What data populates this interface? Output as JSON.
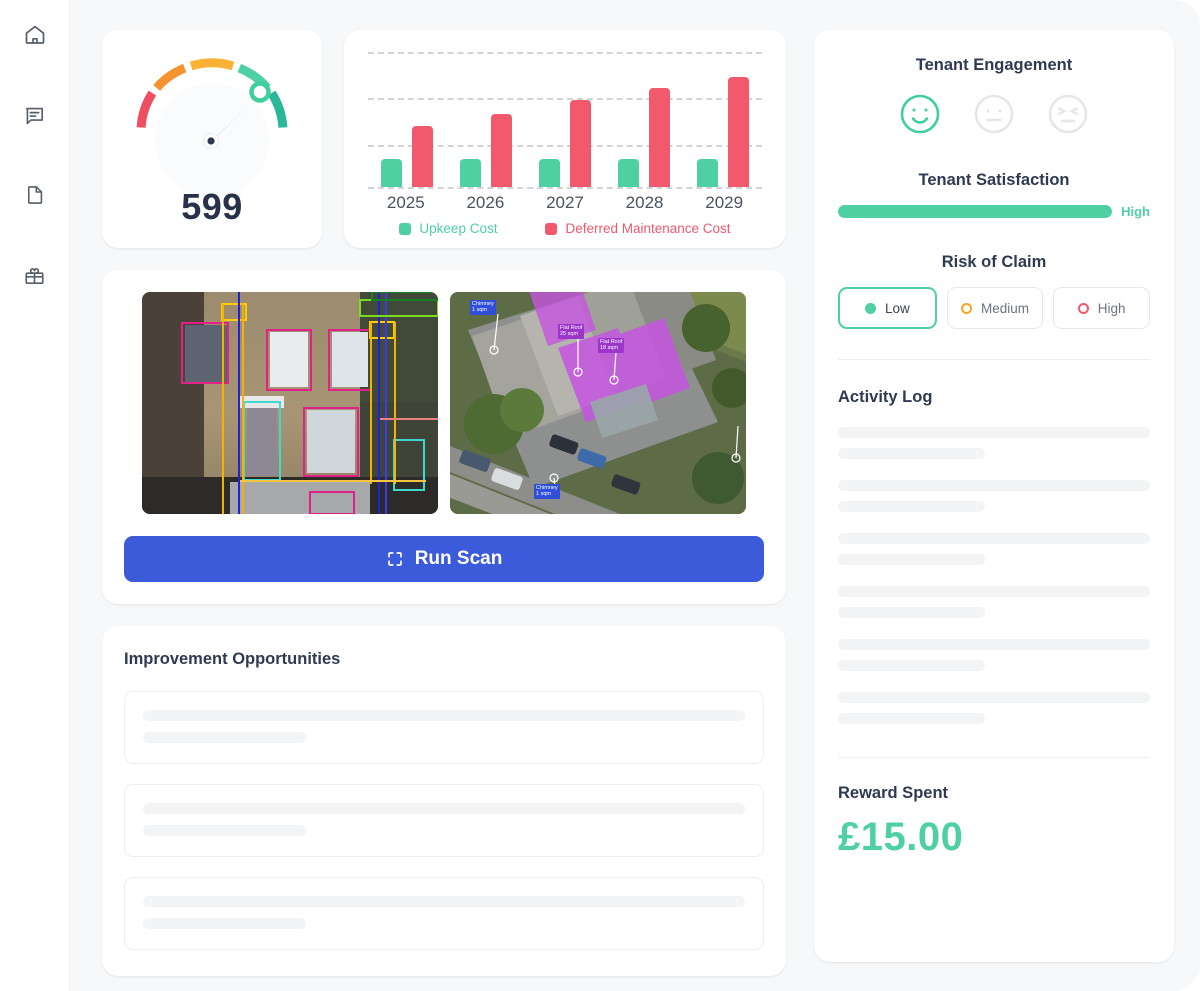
{
  "sidebar": {
    "items": [
      {
        "icon": "home-icon",
        "name": "home"
      },
      {
        "icon": "message-icon",
        "name": "messages"
      },
      {
        "icon": "document-icon",
        "name": "documents"
      },
      {
        "icon": "gift-icon",
        "name": "rewards"
      }
    ]
  },
  "gauge": {
    "value": "599",
    "needle_angle_deg": 48,
    "marker_angle_deg": 48,
    "segments": [
      {
        "name": "poor",
        "color": "#ef4f62"
      },
      {
        "name": "fair",
        "color": "#f5932e"
      },
      {
        "name": "good",
        "color": "#f9b233"
      },
      {
        "name": "very-good",
        "color": "#4ed0a3"
      },
      {
        "name": "excellent",
        "color": "#2bb79a"
      }
    ]
  },
  "chart_data": {
    "type": "bar",
    "title": "",
    "xlabel": "",
    "ylabel": "",
    "categories": [
      "2025",
      "2026",
      "2027",
      "2028",
      "2029"
    ],
    "series": [
      {
        "name": "Upkeep Cost",
        "color": "#4ed0a3",
        "values": [
          20,
          20,
          20,
          20,
          20
        ]
      },
      {
        "name": "Deferred Maintenance Cost",
        "color": "#f2596d",
        "values": [
          43,
          52,
          62,
          70,
          78
        ]
      }
    ],
    "ylim": [
      0,
      100
    ],
    "gridlines": [
      20,
      45,
      70,
      95
    ],
    "grid": true,
    "legend_position": "bottom"
  },
  "scan": {
    "images": [
      {
        "name": "facade-detection-image",
        "alt": "Building facade with AI detection bounding boxes"
      },
      {
        "name": "aerial-roof-detection-image",
        "alt": "Aerial rooftop view with measured roof areas",
        "labels": [
          {
            "text": "Chimney\n1 sqm",
            "color": "#2f4fd8"
          },
          {
            "text": "Flat Roof\n25 sqm",
            "color": "#9b36c9"
          },
          {
            "text": "Flat Roof\n18 sqm",
            "color": "#9b36c9"
          },
          {
            "text": "Chimney\n1 sqm",
            "color": "#2f4fd8"
          }
        ]
      }
    ],
    "run_scan_label": "Run Scan",
    "run_scan_icon": "scan-frame-icon",
    "run_scan_color": "#3b5bdb"
  },
  "improvement": {
    "title": "Improvement Opportunities",
    "placeholder_rows": 3
  },
  "tenant_engagement": {
    "title": "Tenant Engagement",
    "options": [
      {
        "name": "happy",
        "icon": "happy-face-icon",
        "selected": true,
        "color": "#3ecf9b"
      },
      {
        "name": "neutral",
        "icon": "neutral-face-icon",
        "selected": false,
        "color": "#e4e6e9"
      },
      {
        "name": "sad",
        "icon": "sad-face-icon",
        "selected": false,
        "color": "#e4e6e9"
      }
    ]
  },
  "tenant_satisfaction": {
    "title": "Tenant Satisfaction",
    "level_label": "High",
    "percent": 100,
    "color": "#4ed0a3"
  },
  "risk_of_claim": {
    "title": "Risk of Claim",
    "options": [
      {
        "label": "Low",
        "selected": true,
        "marker": "filled",
        "color": "#4ed0a3"
      },
      {
        "label": "Medium",
        "selected": false,
        "marker": "ring",
        "color": "#f5a623"
      },
      {
        "label": "High",
        "selected": false,
        "marker": "ring",
        "color": "#f2596d"
      }
    ]
  },
  "activity_log": {
    "title": "Activity Log",
    "placeholder_rows": 6
  },
  "reward": {
    "title": "Reward Spent",
    "amount": "£15.00",
    "color": "#4ed0a3"
  }
}
